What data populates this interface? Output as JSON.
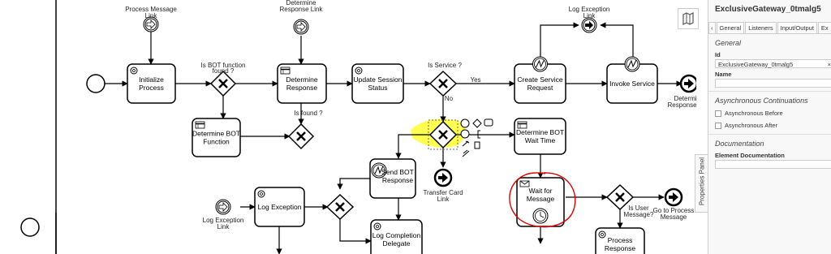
{
  "diagram": {
    "tasks": [
      {
        "id": "t1",
        "lines": [
          "Initialize",
          "Process"
        ]
      },
      {
        "id": "t2",
        "lines": [
          "Determine",
          "Response"
        ]
      },
      {
        "id": "t3",
        "lines": [
          "Update Session",
          "Status"
        ]
      },
      {
        "id": "t4",
        "lines": [
          "Create Service",
          "Request"
        ]
      },
      {
        "id": "t5",
        "lines": [
          "Invoke Service"
        ]
      },
      {
        "id": "t6",
        "lines": [
          "Determine BOT",
          "Function"
        ]
      },
      {
        "id": "t7",
        "lines": [
          "Send BOT",
          "Response"
        ]
      },
      {
        "id": "t8",
        "lines": [
          "Determine BOT",
          "Wait Time"
        ]
      },
      {
        "id": "t9",
        "lines": [
          "Wait for",
          "Message"
        ]
      },
      {
        "id": "t10",
        "lines": [
          "Log Exception"
        ]
      },
      {
        "id": "t11",
        "lines": [
          "Log Completion",
          "Delegate"
        ]
      },
      {
        "id": "t12",
        "lines": [
          "Process",
          "Response"
        ]
      }
    ],
    "labels": {
      "process_message_link": [
        "Process Message",
        "Link"
      ],
      "determine_response_link_top": [
        "Determine",
        "Response Link"
      ],
      "log_exception_link_top": [
        "Log Exception",
        "Link"
      ],
      "determine_response_link_end": [
        "Determine",
        "Response Link"
      ],
      "is_bot_function_found": [
        "Is BOT function",
        "found ?"
      ],
      "is_found": [
        "Is found ?"
      ],
      "is_service": [
        "Is Service ?"
      ],
      "yes": "Yes",
      "no": "No",
      "transfer_card_link": [
        "Transfer Card",
        "Link"
      ],
      "log_exception_link_left": [
        "Log Exception",
        "Link"
      ],
      "is_user_message": [
        "Is User",
        "Message?"
      ],
      "go_to_process_message": [
        "Go to Process",
        "Message"
      ]
    }
  },
  "properties_panel": {
    "tab_label": "Properties Panel",
    "title": "ExclusiveGateway_0tmalg5",
    "tabs": [
      "‹",
      "General",
      "Listeners",
      "Input/Output",
      "Ex"
    ],
    "general_heading": "General",
    "id_label": "Id",
    "id_value": "ExclusiveGateway_0tmalg5",
    "clear_icon": "×",
    "name_label": "Name",
    "name_value": "",
    "async_heading": "Asynchronous Continuations",
    "async_before": "Asynchronous Before",
    "async_after": "Asynchronous After",
    "documentation_heading": "Documentation",
    "element_documentation_label": "Element Documentation"
  },
  "colors": {
    "highlight": "#ffff00",
    "annotation_circle": "#e00000"
  },
  "icons": [
    "map-icon",
    "exclusive-gateway-icon",
    "link-event-icon",
    "timer-icon",
    "message-icon",
    "service-task-icon",
    "business-rule-icon"
  ]
}
